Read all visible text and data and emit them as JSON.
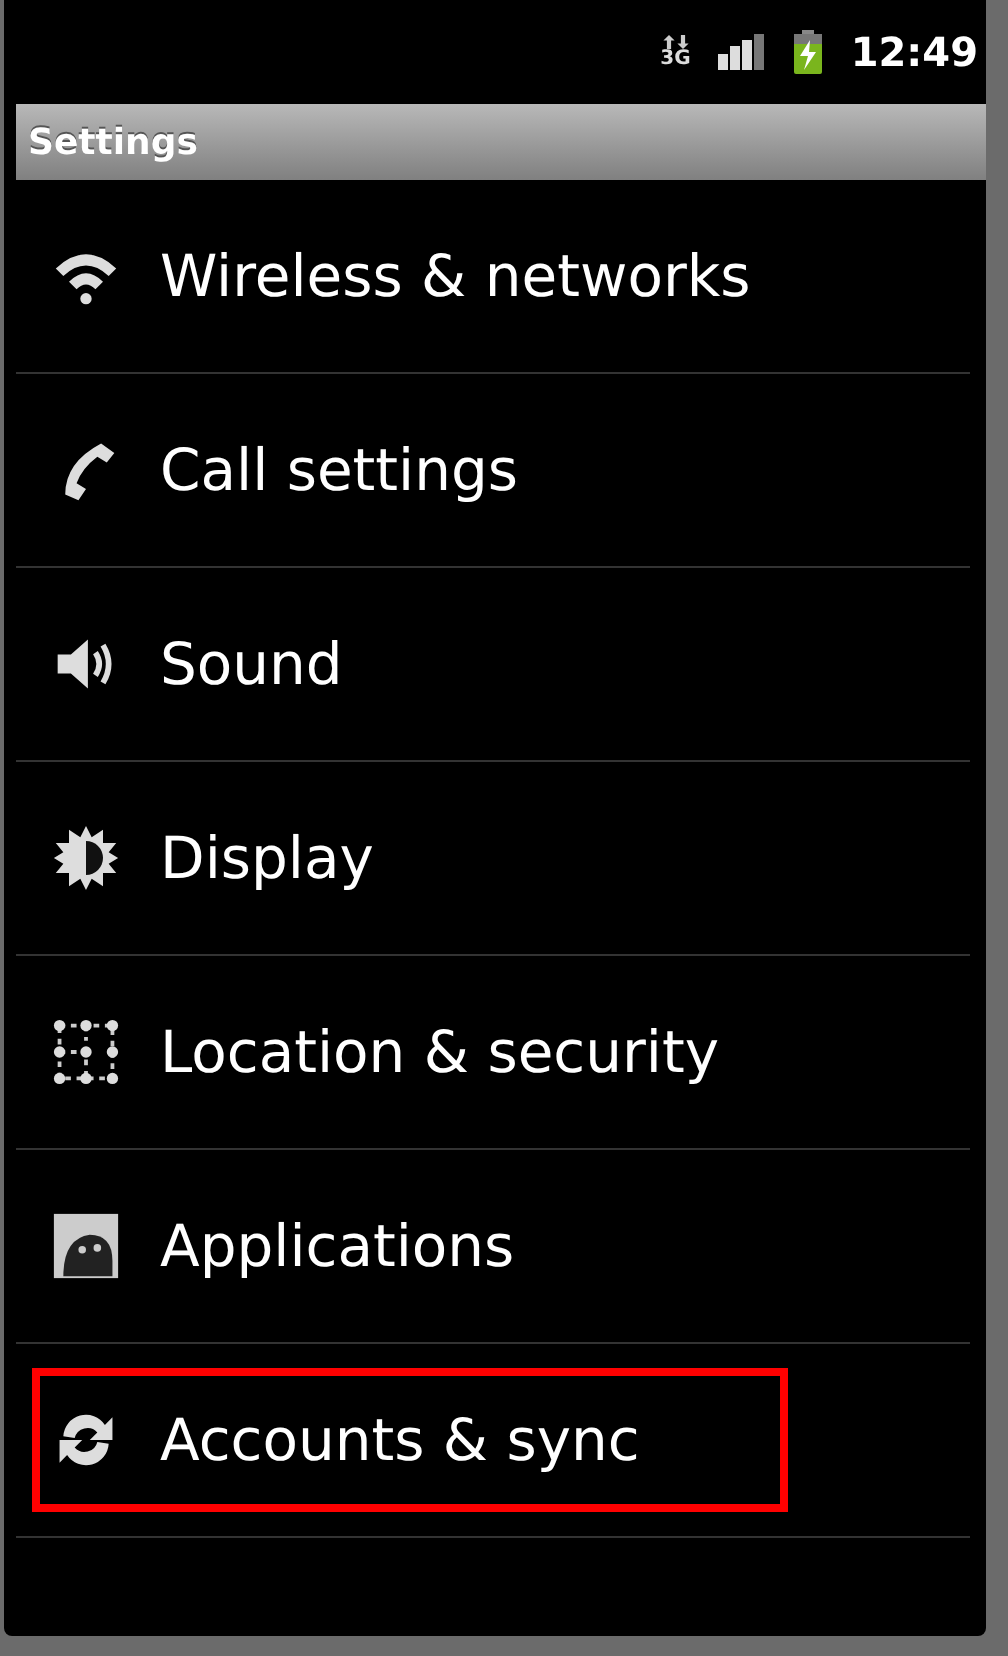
{
  "status_bar": {
    "network": "3G",
    "time": "12:49"
  },
  "title_bar": {
    "title": "Settings"
  },
  "items": [
    {
      "kind": "wifi",
      "label": "Wireless & networks",
      "highlighted": false
    },
    {
      "kind": "phone",
      "label": "Call settings",
      "highlighted": false
    },
    {
      "kind": "sound",
      "label": "Sound",
      "highlighted": false
    },
    {
      "kind": "display",
      "label": "Display",
      "highlighted": false
    },
    {
      "kind": "location",
      "label": "Location & security",
      "highlighted": false
    },
    {
      "kind": "apps",
      "label": "Applications",
      "highlighted": false
    },
    {
      "kind": "sync",
      "label": "Accounts & sync",
      "highlighted": true
    }
  ]
}
